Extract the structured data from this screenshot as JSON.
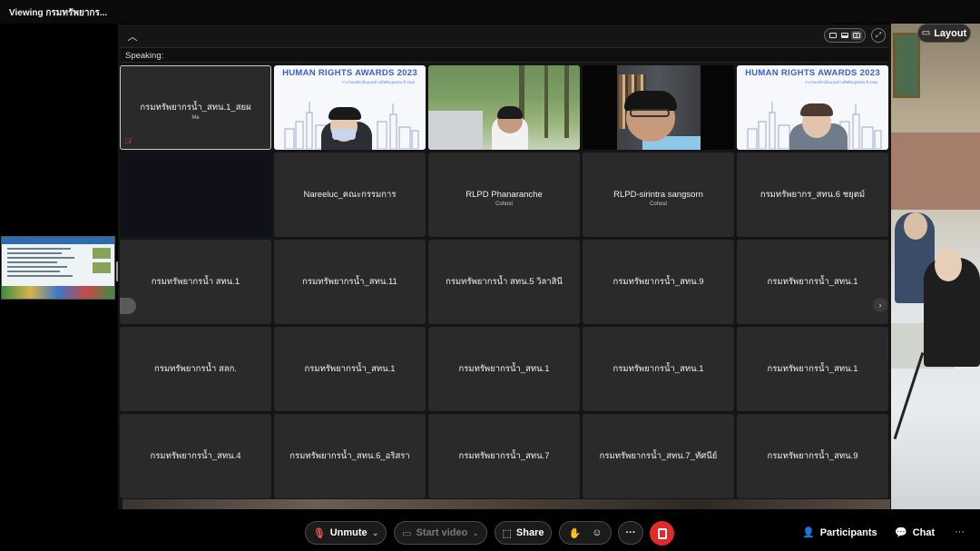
{
  "window": {
    "title": "Viewing กรมทรัพยากร..."
  },
  "layout_button": {
    "label": "Layout"
  },
  "speaking": {
    "label": "Speaking:"
  },
  "hra_banner": {
    "title": "HUMAN RIGHTS AWARDS 2023",
    "subtitle": "รางวัลองค์กรต้นแบบด้านสิทธิมนุษยชน ปี 2566"
  },
  "tiles": [
    {
      "name": "กรมทรัพยากรน้ำ_สทน.1_สยผ",
      "role": "Me",
      "video": "none",
      "active": true,
      "muted": true
    },
    {
      "name": "",
      "role": "",
      "video": "hra-woman1"
    },
    {
      "name": "",
      "role": "",
      "video": "forest-man"
    },
    {
      "name": "",
      "role": "",
      "video": "office-man"
    },
    {
      "name": "",
      "role": "",
      "video": "hra-woman2"
    },
    {
      "name": "",
      "role": "",
      "video": "dark"
    },
    {
      "name": "Nareeluc_คณะกรรมการ",
      "role": ""
    },
    {
      "name": "RLPD Phanaranche",
      "role": "Cohost"
    },
    {
      "name": "RLPD-sirintra sangsorn",
      "role": "Cohost"
    },
    {
      "name": "กรมทรัพยากร_สทน.6 ชยุตม์",
      "role": ""
    },
    {
      "name": "กรมทรัพยากรน้ำ สทน.1",
      "role": ""
    },
    {
      "name": "กรมทรัพยากรน้ำ_สทน.11",
      "role": ""
    },
    {
      "name": "กรมทรัพยากรน้ำ สทน.5 วิลาสินี",
      "role": ""
    },
    {
      "name": "กรมทรัพยากรน้ำ_สทน.9",
      "role": ""
    },
    {
      "name": "กรมทรัพยากรน้ำ_สทน.1",
      "role": ""
    },
    {
      "name": "กรมทรัพยากรน้ำ สลก.",
      "role": ""
    },
    {
      "name": "กรมทรัพยากรน้ำ_สทน.1",
      "role": ""
    },
    {
      "name": "กรมทรัพยากรน้ำ_สทน.1",
      "role": ""
    },
    {
      "name": "กรมทรัพยากรน้ำ_สทน.1",
      "role": ""
    },
    {
      "name": "กรมทรัพยากรน้ำ_สทน.1",
      "role": ""
    },
    {
      "name": "กรมทรัพยากรน้ำ_สทน.4",
      "role": ""
    },
    {
      "name": "กรมทรัพยากรน้ำ_สทน.6_อริสรา",
      "role": ""
    },
    {
      "name": "กรมทรัพยากรน้ำ_สทน.7",
      "role": ""
    },
    {
      "name": "กรมทรัพยากรน้ำ_สทน.7_ทัศนีย์",
      "role": ""
    },
    {
      "name": "กรมทรัพยากรน้ำ_สทน.9",
      "role": ""
    }
  ],
  "controls": {
    "unmute": "Unmute",
    "start_video": "Start video",
    "share": "Share",
    "participants": "Participants",
    "chat": "Chat",
    "more": "···"
  },
  "icons": {
    "mic_muted": "mic-muted-icon",
    "video_off": "video-off-icon",
    "share": "share-icon",
    "hand": "raise-hand-icon",
    "emoji": "emoji-icon",
    "leave": "leave-icon",
    "participants": "participants-icon",
    "chat": "chat-icon"
  },
  "colors": {
    "leave": "#e02b2b",
    "hra_blue": "#3c5ed8",
    "muted_red": "#e25555"
  }
}
